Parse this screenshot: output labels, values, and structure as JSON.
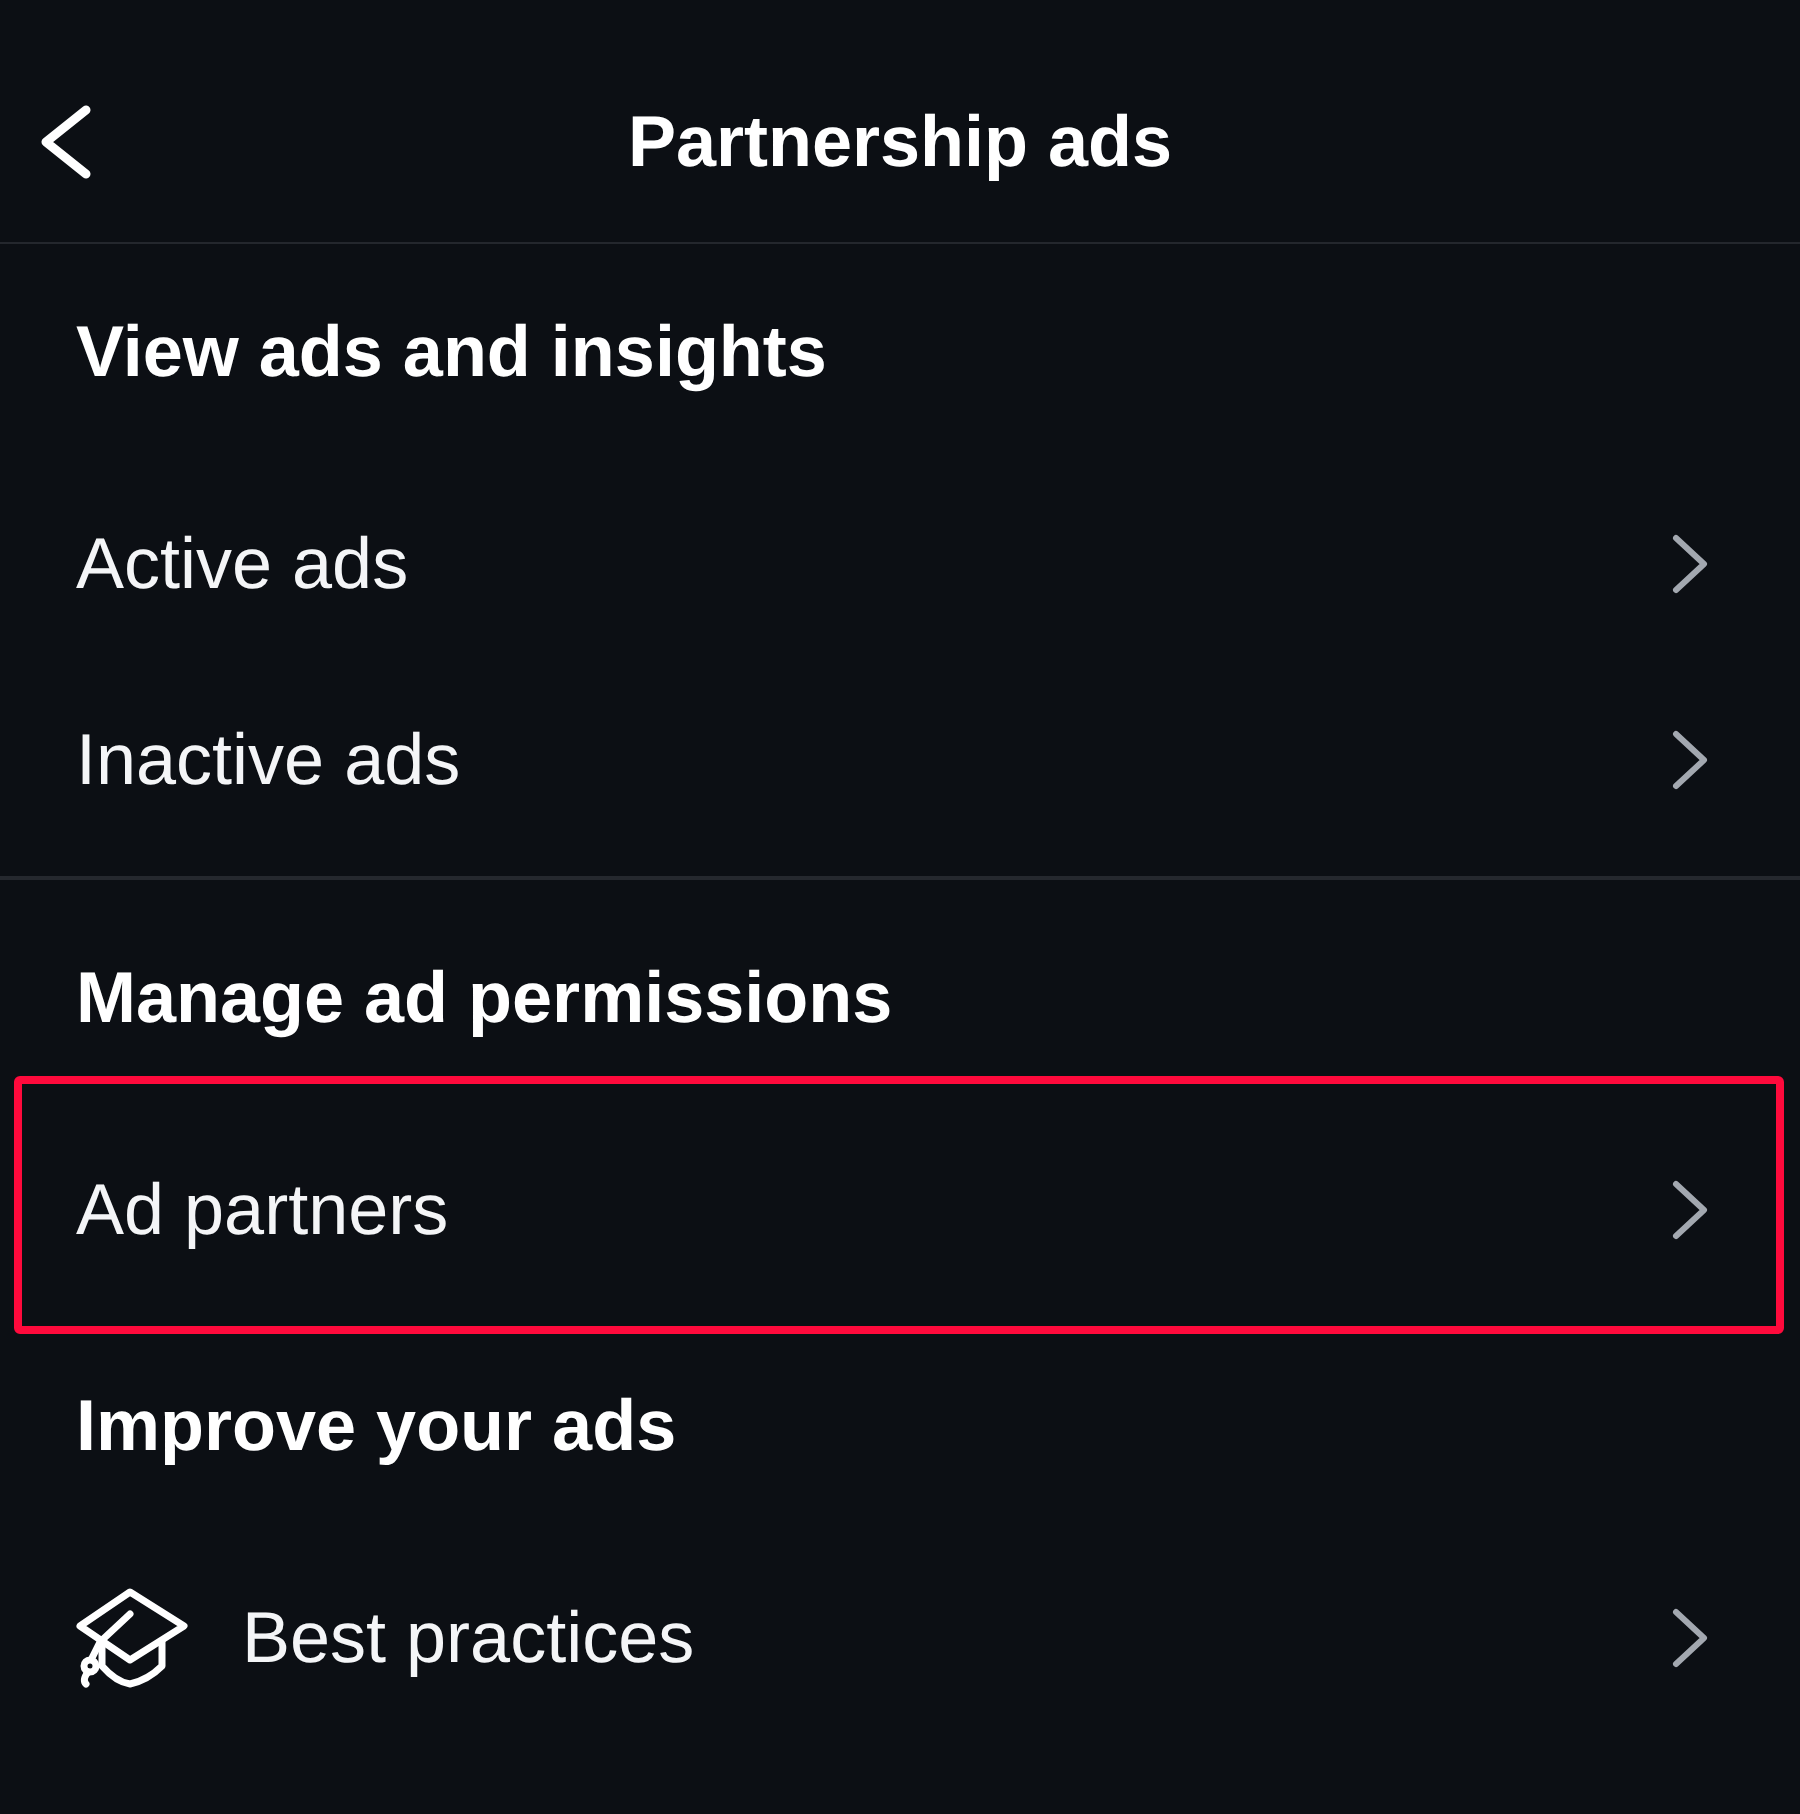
{
  "header": {
    "title": "Partnership ads"
  },
  "sections": [
    {
      "title": "View ads and insights",
      "divider_after": true,
      "items": [
        {
          "label": "Active ads",
          "kind": "plain",
          "highlighted": false
        },
        {
          "label": "Inactive ads",
          "kind": "plain",
          "highlighted": false
        }
      ]
    },
    {
      "title": "Manage ad permissions",
      "divider_after": false,
      "items": [
        {
          "label": "Ad partners",
          "kind": "plain",
          "highlighted": true
        }
      ]
    },
    {
      "title": "Improve your ads",
      "divider_after": false,
      "items": [
        {
          "label": "Best practices",
          "kind": "icon",
          "highlighted": false
        }
      ]
    }
  ]
}
